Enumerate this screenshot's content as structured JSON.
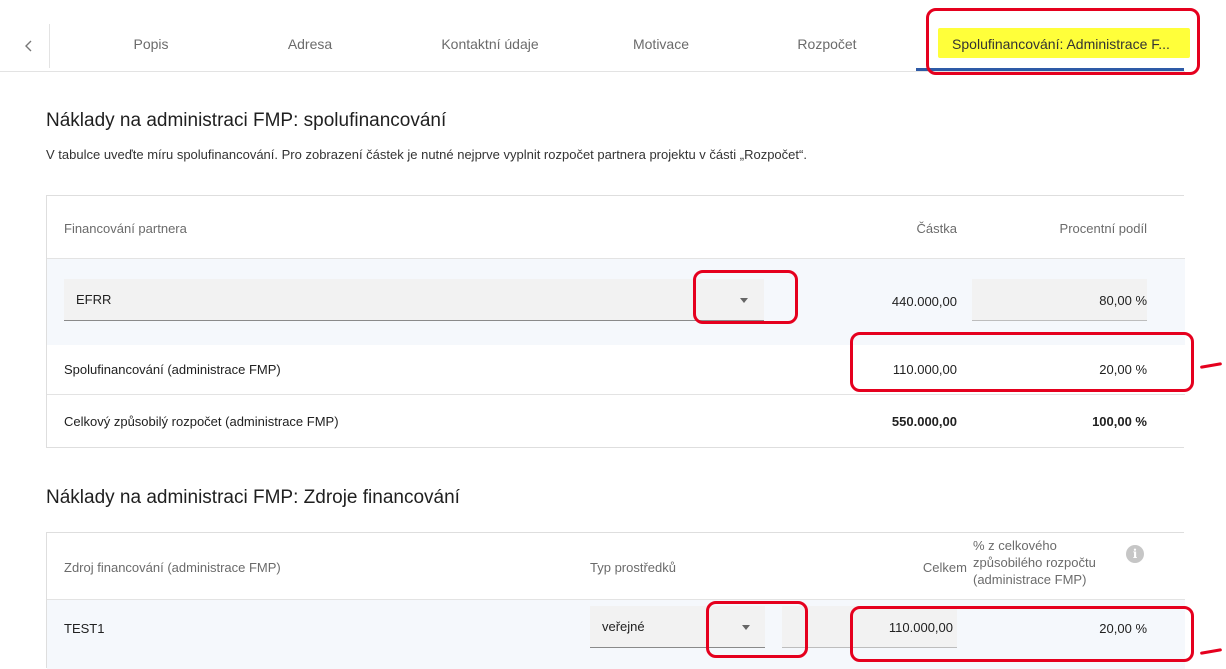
{
  "tabs": {
    "items": [
      {
        "label": "Popis"
      },
      {
        "label": "Adresa"
      },
      {
        "label": "Kontaktní údaje"
      },
      {
        "label": "Motivace"
      },
      {
        "label": "Rozpočet"
      },
      {
        "label": "Spolufinancování: Administrace F..."
      }
    ]
  },
  "section1": {
    "title": "Náklady na administraci FMP: spolufinancování",
    "description": "V tabulce uveďte míru spolufinancování. Pro zobrazení částek je nutné nejprve vyplnit rozpočet partnera projektu v části „Rozpočet“.",
    "headers": {
      "financing": "Financování partnera",
      "amount": "Částka",
      "percent": "Procentní podíl"
    },
    "rows": [
      {
        "label": "EFRR",
        "amount": "440.000,00",
        "percent": "80,00 %"
      },
      {
        "label": "Spolufinancování (administrace FMP)",
        "amount": "110.000,00",
        "percent": "20,00 %"
      },
      {
        "label": "Celkový způsobilý rozpočet (administrace FMP)",
        "amount": "550.000,00",
        "percent": "100,00 %"
      }
    ]
  },
  "section2": {
    "title": "Náklady na administraci FMP: Zdroje financování",
    "headers": {
      "source": "Zdroj financování (administrace FMP)",
      "type": "Typ prostředků",
      "total": "Celkem",
      "percent_line1": "% z celkového",
      "percent_line2": "způsobilého rozpočtu",
      "percent_line3": "(administrace FMP)"
    },
    "rows": [
      {
        "source": "TEST1",
        "type": "veřejné",
        "total": "110.000,00",
        "percent": "20,00 %"
      }
    ]
  },
  "icons": {
    "back": "chevron-left-icon",
    "info": "info-icon",
    "dropdown": "caret-down-icon"
  },
  "colors": {
    "accent": "#2e5aa6",
    "highlight": "#ffff3a",
    "annotation": "#e5001e"
  }
}
